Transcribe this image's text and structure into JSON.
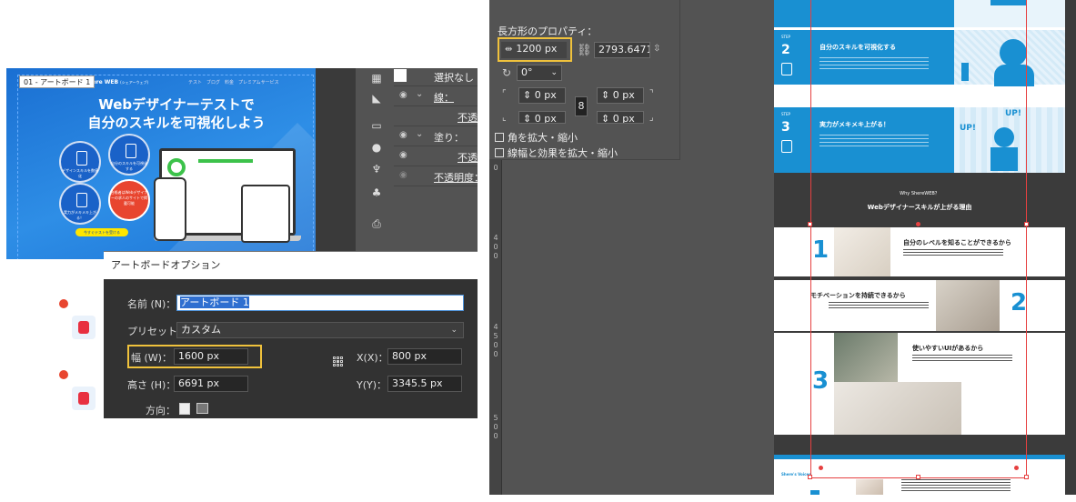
{
  "left_screenshot": {
    "artboard_label": "01 - アートボード 1",
    "site_name": "Shere WEB",
    "site_name_sub": "(シェアーウェブ)",
    "site_nav": "テスト　ブログ　料金　プレミアムサービス",
    "hero_title_line1": "Webデザイナーテストで",
    "hero_title_line2": "自分のスキルを可視化しよう",
    "step_circles": [
      {
        "text": "デザインスキルを数値化"
      },
      {
        "text": "自分のスキルを可視化する"
      },
      {
        "text": "実力がメキメキ上がる！"
      },
      {
        "text": "合格者はWebデザイナーの求人のサイトで掲載可能"
      }
    ],
    "cta_button": "今すぐテストを受ける",
    "layers_panel": {
      "rows": [
        {
          "label": "選択なし"
        },
        {
          "label": "線："
        },
        {
          "label": "不透明"
        },
        {
          "label": "塗り："
        },
        {
          "label": "不透明"
        },
        {
          "label": "不透明度："
        }
      ]
    },
    "dialog": {
      "title": "アートボードオプション",
      "name_label": "名前 (N)：",
      "name_value": "アートボード 1",
      "preset_label": "プリセット (P)：",
      "preset_value": "カスタム",
      "width_label": "幅 (W)：",
      "width_value": "1600 px",
      "height_label": "高さ (H)：",
      "height_value": "6691 px",
      "x_label": "X(X)：",
      "x_value": "800 px",
      "y_label": "Y(Y)：",
      "y_value": "3345.5 px",
      "orientation_label": "方向："
    }
  },
  "right_screenshot": {
    "properties": {
      "title": "長方形のプロパティ：",
      "width_value": "1200 px",
      "height_value": "2793.6471",
      "rotation_value": "0°",
      "corner_tl": "0 px",
      "corner_tr": "0 px",
      "corner_bl": "0 px",
      "corner_br": "0 px",
      "checkbox_corners": "角を拡大・縮小",
      "checkbox_stroke": "線幅と効果を拡大・縮小"
    },
    "ruler_ticks": [
      "0",
      "4",
      "0",
      "0",
      "4",
      "5",
      "0",
      "0",
      "5",
      "0",
      "0"
    ],
    "steps": [
      {
        "label": "STEP",
        "number": "2",
        "title": "自分のスキルを可視化する"
      },
      {
        "label": "STEP",
        "number": "3",
        "title": "実力がメキメキ上がる！"
      }
    ],
    "illus_text": "UP!",
    "why": {
      "tag": "Why ShereWEB？",
      "title": "Webデザイナースキルが上がる理由"
    },
    "reasons": [
      {
        "number": "1",
        "title": "自分のレベルを知ることができるから"
      },
      {
        "number": "2",
        "title": "モチベーションを持続できるから"
      },
      {
        "number": "3",
        "title": "使いやすいUIがあるから"
      }
    ],
    "bottom_tag": "Shere's Voices"
  },
  "colors": {
    "blue": "#1990d2",
    "highlight": "#f0c23c",
    "selection_red": "#e64040",
    "dark_panel": "#535353"
  }
}
